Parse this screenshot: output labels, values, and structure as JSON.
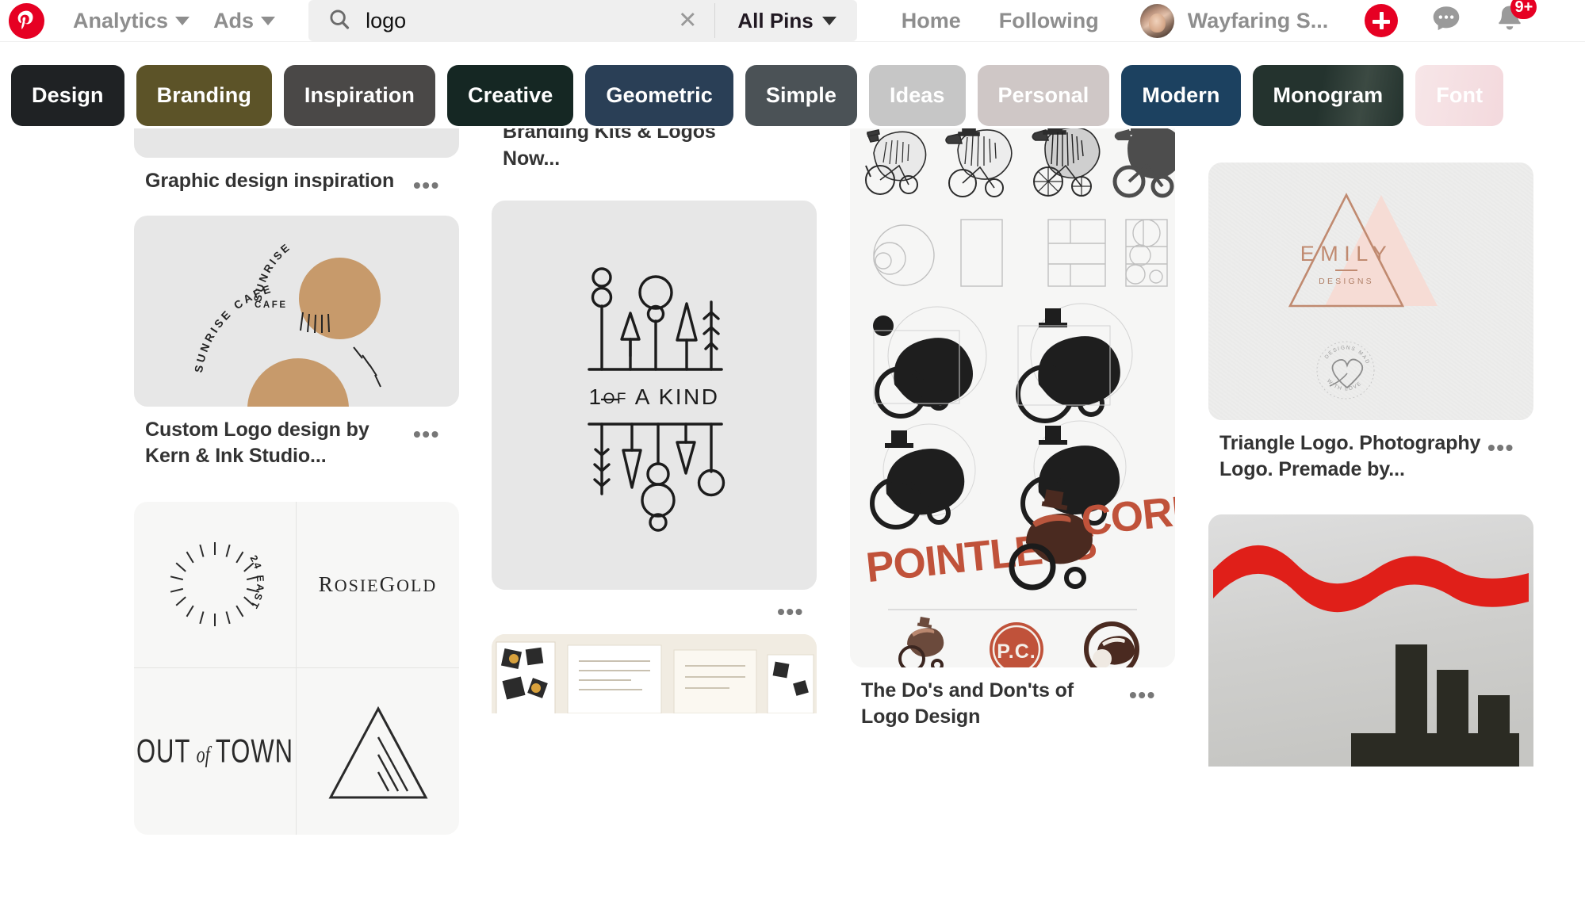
{
  "app": {
    "name": "Pinterest",
    "logo_icon": "pinterest-logo-icon"
  },
  "header": {
    "nav": [
      {
        "label": "Analytics",
        "icon": "chevron-down-icon"
      },
      {
        "label": "Ads",
        "icon": "chevron-down-icon"
      }
    ],
    "search": {
      "icon": "search-icon",
      "value": "logo",
      "placeholder": "Search",
      "clear_icon": "close-icon",
      "clear_label": "✕"
    },
    "scope": {
      "label": "All Pins",
      "icon": "chevron-down-icon"
    },
    "links": [
      {
        "label": "Home"
      },
      {
        "label": "Following"
      }
    ],
    "account": {
      "avatar_icon": "avatar",
      "username": "Wayfaring S..."
    },
    "actions": [
      {
        "name": "create-pin-button",
        "icon": "plus-icon",
        "label": "+"
      },
      {
        "name": "messages-button",
        "icon": "chat-bubble-icon"
      },
      {
        "name": "notifications-button",
        "icon": "bell-icon",
        "badge": "9+"
      }
    ]
  },
  "filters": {
    "pills": [
      {
        "label": "Design",
        "bg": "#1f2224",
        "fg": "#ffffff"
      },
      {
        "label": "Branding",
        "bg": "#5c5328",
        "fg": "#ffffff"
      },
      {
        "label": "Inspiration",
        "bg": "#4a4847",
        "fg": "#ffffff"
      },
      {
        "label": "Creative",
        "bg": "#152723",
        "fg": "#ffffff"
      },
      {
        "label": "Geometric",
        "bg": "#2a3f56",
        "fg": "#ffffff"
      },
      {
        "label": "Simple",
        "bg": "#4b5256",
        "fg": "#ffffff"
      },
      {
        "label": "Ideas",
        "bg": "#c6c6c6",
        "fg": "#ffffff"
      },
      {
        "label": "Personal",
        "bg": "#cfc7c6",
        "fg": "#ffffff"
      },
      {
        "label": "Modern",
        "bg": "#1c4160",
        "fg": "#ffffff"
      },
      {
        "label": "Monogram",
        "bg": "#24332e",
        "fg": "#ffffff"
      },
      {
        "label": "Font",
        "bg": "#f5dfe2",
        "fg": "#ffffff"
      }
    ]
  },
  "grid": {
    "columns": [
      {
        "name": "column-1",
        "pins": [
          {
            "id": "pin-graphic-design-inspiration",
            "title": "Graphic design inspiration",
            "image_kind": "placeholder",
            "overflow_icon": "more-options-icon",
            "overflow_label": "•••"
          },
          {
            "id": "pin-sunrise-cafe",
            "title": "Custom Logo design by Kern & Ink Studio...",
            "image_kind": "sunrise-cafe-logo",
            "logo_text": {
              "brand": "SUNRISE",
              "sub": "CAFE"
            },
            "overflow_icon": "more-options-icon",
            "overflow_label": "•••"
          },
          {
            "id": "pin-logo-grid-fourup",
            "title": "",
            "image_kind": "four-up-logo-grid",
            "cells": [
              "24 EAST",
              "ROSIEGOLD",
              "OUT of TOWN",
              "triangle-mark"
            ],
            "overflow_icon": "more-options-icon",
            "overflow_label": "•••"
          }
        ]
      },
      {
        "name": "column-2",
        "pins": [
          {
            "id": "pin-premade-branding-kits",
            "title": "Shop. Redesigned Premade Branding Kits & Logos Now...",
            "image_kind": "clipped-top",
            "overflow_icon": "more-options-icon",
            "overflow_label": "•••"
          },
          {
            "id": "pin-one-of-a-kind",
            "title": "",
            "image_kind": "one-of-a-kind-logo",
            "logo_text": {
              "one": "1",
              "of": "OF",
              "akind": "A KIND"
            },
            "overflow_icon": "more-options-icon",
            "overflow_label": "•••"
          },
          {
            "id": "pin-stationery-mockup",
            "title": "",
            "image_kind": "stationery-mockup",
            "overflow_icon": "more-options-icon",
            "overflow_label": "•••"
          }
        ]
      },
      {
        "name": "column-3",
        "pins": [
          {
            "id": "pin-dos-and-donts-logo-design",
            "title": "The Do's and Don'ts of Logo Design",
            "image_kind": "pointless-corp-process-sheet",
            "logo_text": {
              "wordmark_left": "POINTLESS",
              "wordmark_right": "CORP.",
              "badge": "P.C."
            },
            "overflow_icon": "more-options-icon",
            "overflow_label": "•••"
          }
        ]
      },
      {
        "name": "column-4",
        "pins": [
          {
            "id": "pin-triangle-logo-emily",
            "title": "Triangle Logo. Photography Logo. Premade by...",
            "image_kind": "emily-designs-logo",
            "logo_text": {
              "brand": "EMILY",
              "sub": "DESIGNS",
              "stamp": "DESIGNS MADE WITH LOVE"
            },
            "overflow_icon": "more-options-icon",
            "overflow_label": "•••"
          },
          {
            "id": "pin-red-wave-factory",
            "title": "",
            "image_kind": "red-wave-factory-poster",
            "overflow_icon": "more-options-icon",
            "overflow_label": "•••"
          }
        ]
      }
    ]
  },
  "colors": {
    "brand_red": "#e60023",
    "text_dark": "#333333",
    "text_muted": "#8e8e8e",
    "placeholder_gray": "#e6e6e6",
    "sunrise_tan": "#c79a6b",
    "emily_rose": "#c08a70",
    "emily_pink": "#f6dcd5",
    "pointless_red": "#c0523a",
    "pointless_brown": "#4a2a20",
    "poster_red": "#e01f19"
  }
}
